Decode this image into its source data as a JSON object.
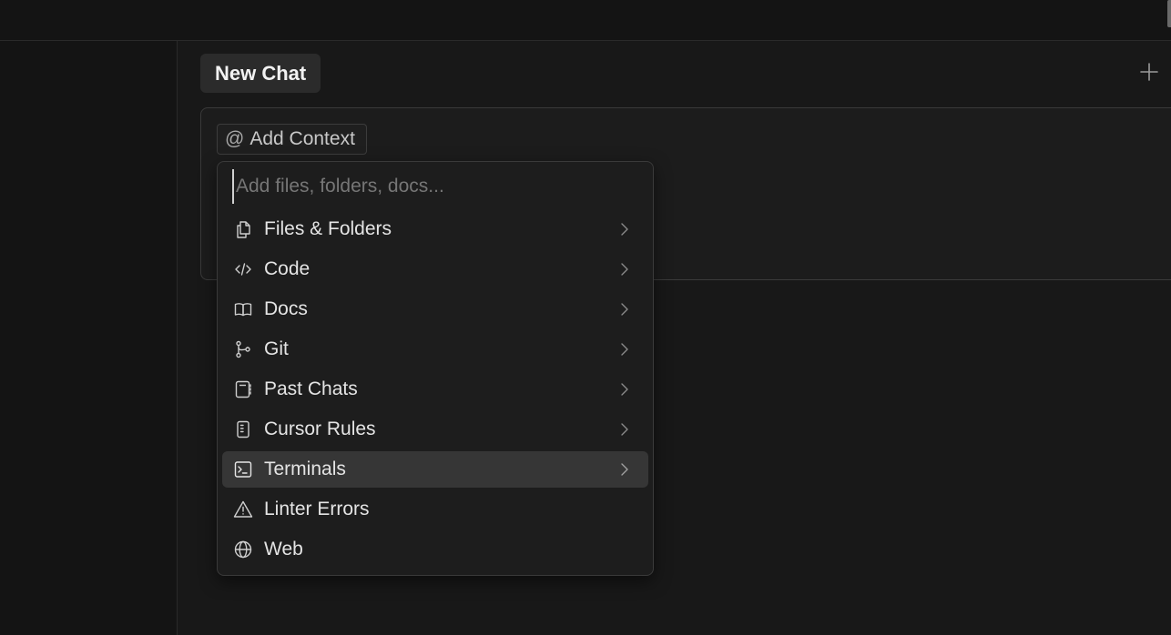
{
  "chat": {
    "title": "New Chat",
    "new_chat_icon": "plus-icon"
  },
  "composer": {
    "add_context_symbol": "@",
    "add_context_label": "Add Context"
  },
  "context_menu": {
    "search_placeholder": "Add files, folders, docs...",
    "search_value": "",
    "items": [
      {
        "label": "Files & Folders",
        "icon": "files-icon",
        "has_submenu": true
      },
      {
        "label": "Code",
        "icon": "code-icon",
        "has_submenu": true
      },
      {
        "label": "Docs",
        "icon": "book-icon",
        "has_submenu": true
      },
      {
        "label": "Git",
        "icon": "git-branch-icon",
        "has_submenu": true
      },
      {
        "label": "Past Chats",
        "icon": "notebook-icon",
        "has_submenu": true
      },
      {
        "label": "Cursor Rules",
        "icon": "rules-icon",
        "has_submenu": true
      },
      {
        "label": "Terminals",
        "icon": "terminal-icon",
        "has_submenu": true,
        "selected": true
      },
      {
        "label": "Linter Errors",
        "icon": "warning-icon",
        "has_submenu": false
      },
      {
        "label": "Web",
        "icon": "globe-icon",
        "has_submenu": false
      }
    ]
  },
  "colors": {
    "background": "#141414",
    "panel": "#181818",
    "menu_background": "#1d1d1d",
    "selected_item": "#363636",
    "text": "#e4e4e4",
    "placeholder": "#767676"
  }
}
